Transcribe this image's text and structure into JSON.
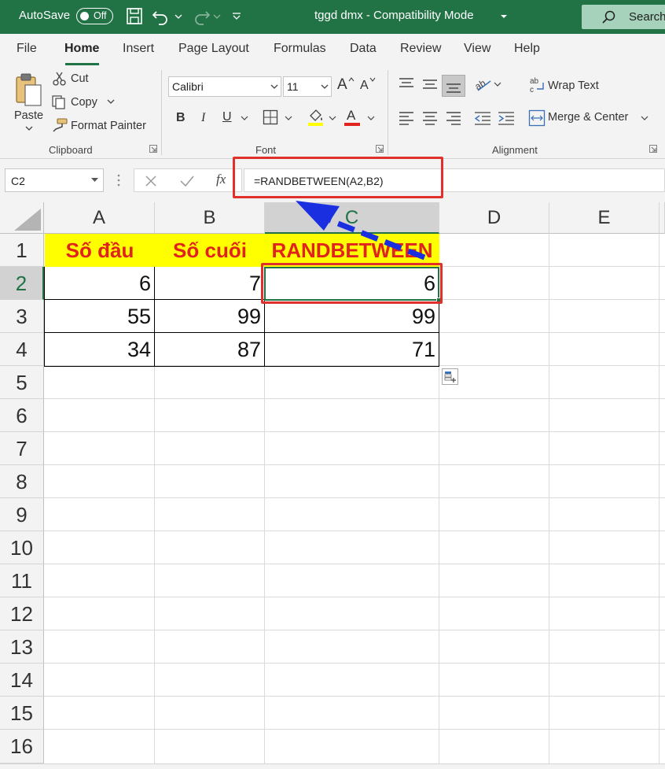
{
  "titlebar": {
    "autosave_label": "AutoSave",
    "autosave_state": "Off",
    "title": "tggd dmx  -  Compatibility Mode",
    "search_label": "Search"
  },
  "tabs": [
    "File",
    "Home",
    "Insert",
    "Page Layout",
    "Formulas",
    "Data",
    "Review",
    "View",
    "Help"
  ],
  "active_tab": "Home",
  "clipboard": {
    "paste": "Paste",
    "cut": "Cut",
    "copy": "Copy",
    "format_painter": "Format Painter",
    "group": "Clipboard"
  },
  "font": {
    "name": "Calibri",
    "size": "11",
    "bold": "B",
    "italic": "I",
    "underline": "U",
    "grow": "A",
    "shrink": "A",
    "color_glyph": "A",
    "group": "Font"
  },
  "alignment": {
    "wrap_text": "Wrap Text",
    "merge_center": "Merge & Center",
    "group": "Alignment"
  },
  "formula_bar": {
    "name_box": "C2",
    "fx": "fx",
    "formula": "=RANDBETWEEN(A2,B2)"
  },
  "colors": {
    "excel_green": "#217346",
    "highlight_red": "#e0302c",
    "header_yellow": "#ffff00",
    "header_text_red": "#e0231c",
    "arrow_blue": "#1a2fe0"
  },
  "grid": {
    "columns": [
      "A",
      "B",
      "C",
      "D",
      "E"
    ],
    "rows": [
      "1",
      "2",
      "3",
      "4",
      "5",
      "6",
      "7",
      "8",
      "9",
      "10",
      "11",
      "12",
      "13",
      "14",
      "15",
      "16"
    ],
    "selected_column": "C",
    "selected_row": "2",
    "header_row": [
      "Số đầu",
      "Số cuối",
      "RANDBETWEEN"
    ],
    "data_rows": [
      [
        "6",
        "7",
        "6"
      ],
      [
        "55",
        "99",
        "99"
      ],
      [
        "34",
        "87",
        "71"
      ]
    ]
  }
}
